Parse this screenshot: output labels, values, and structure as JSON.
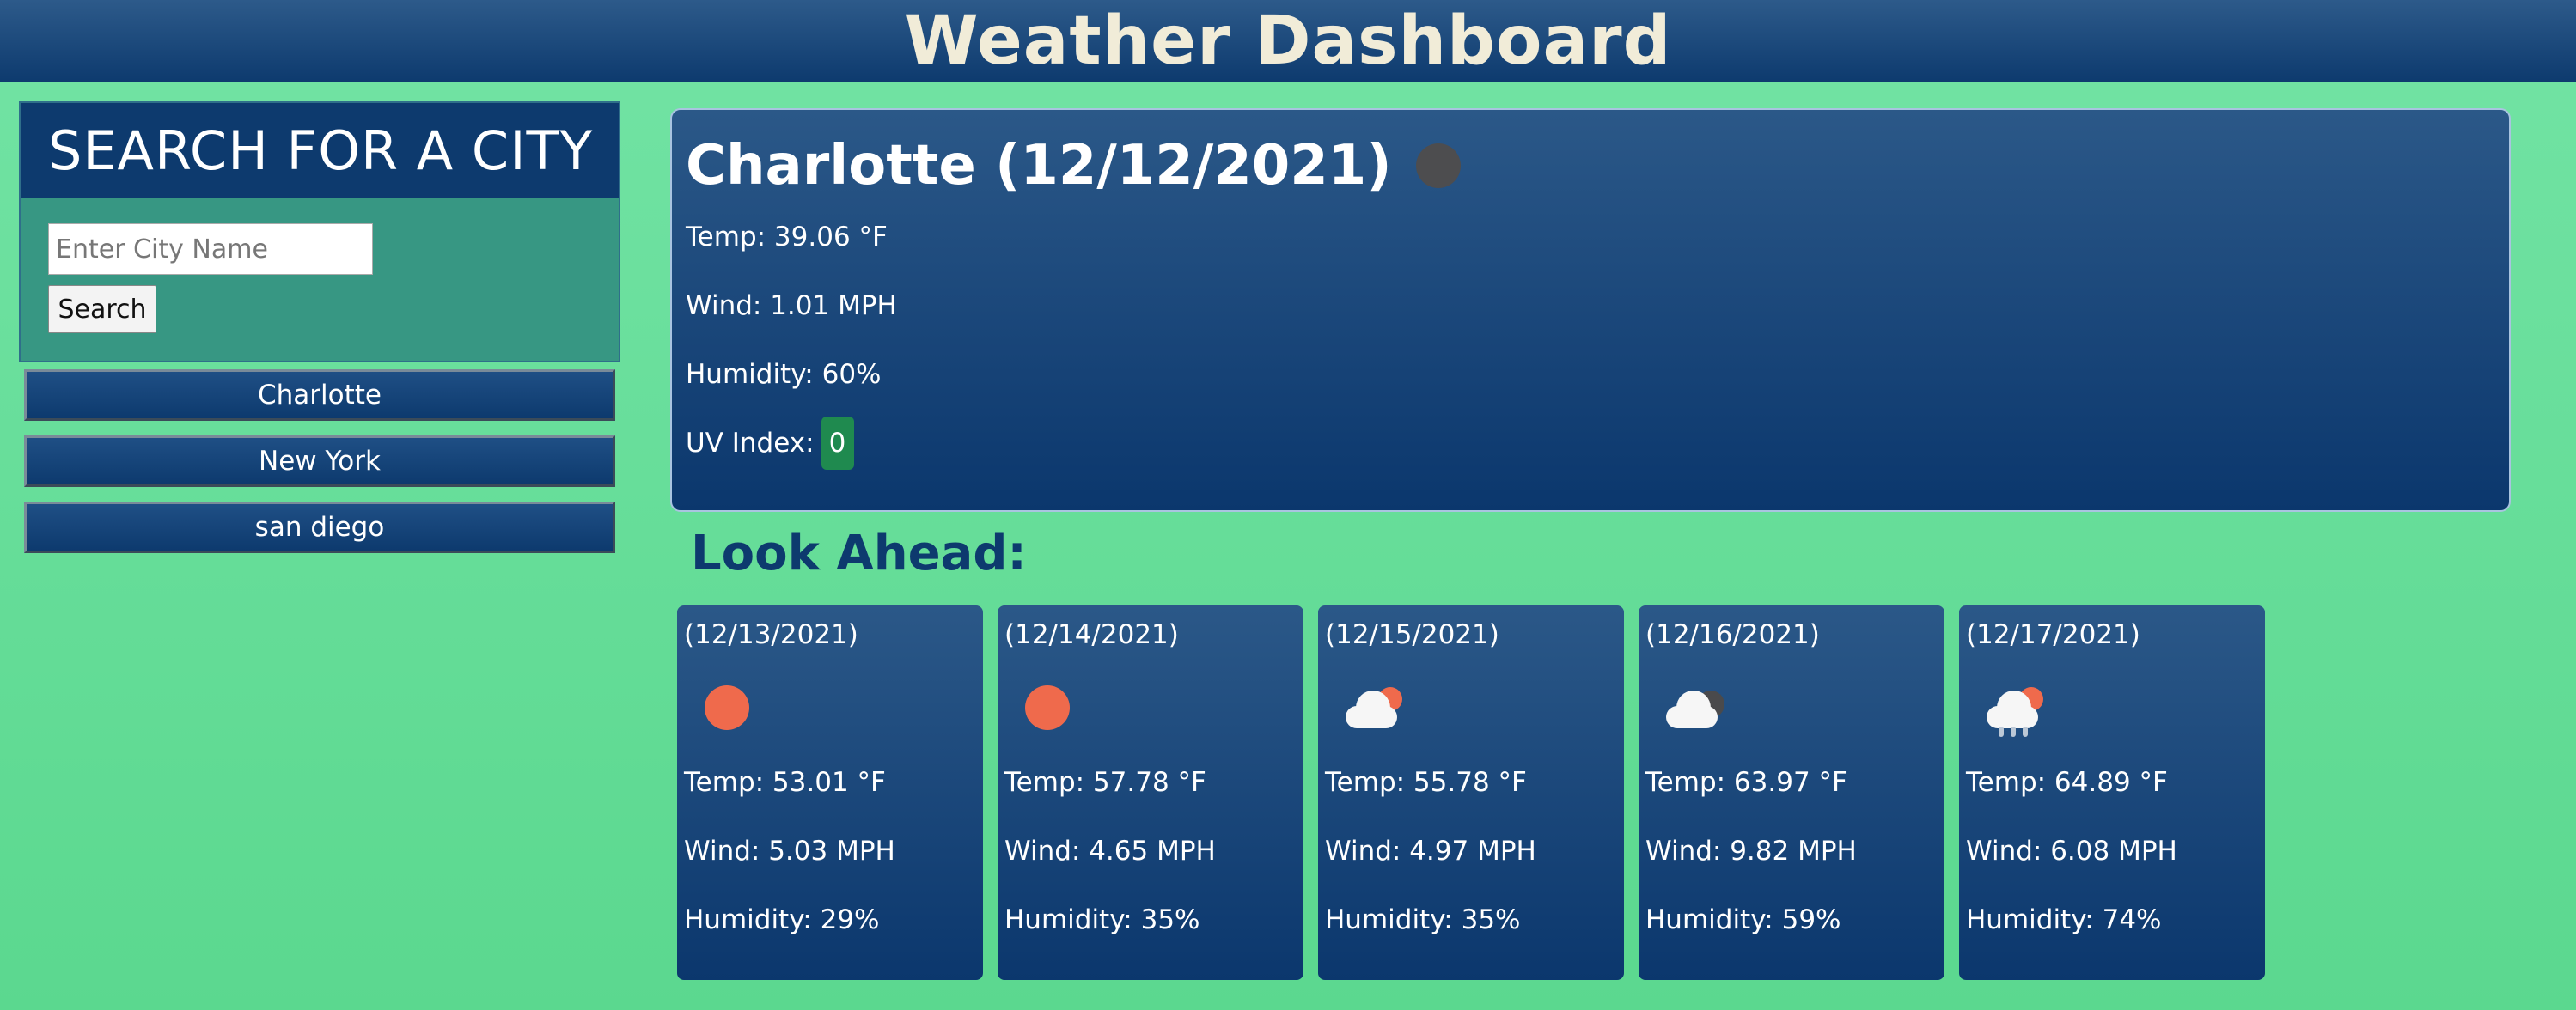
{
  "header": {
    "title": "Weather Dashboard"
  },
  "search": {
    "title": "SEARCH FOR A CITY",
    "placeholder": "Enter City Name",
    "value": "",
    "button_label": "Search"
  },
  "history": [
    "Charlotte",
    "New York",
    "san diego"
  ],
  "current": {
    "title": "Charlotte (12/12/2021)",
    "icon": "moon-icon",
    "temp": "Temp: 39.06 °F",
    "wind": "Wind: 1.01 MPH",
    "humidity": "Humidity: 60%",
    "uv_label": "UV Index:",
    "uv_value": "0",
    "uv_color": "#1f8a4f"
  },
  "forecast_title": "Look Ahead:",
  "forecast": [
    {
      "date": "(12/13/2021)",
      "icon": "sun-icon",
      "temp": "Temp: 53.01 °F",
      "wind": "Wind: 5.03 MPH",
      "humidity": "Humidity: 29%"
    },
    {
      "date": "(12/14/2021)",
      "icon": "sun-icon",
      "temp": "Temp: 57.78 °F",
      "wind": "Wind: 4.65 MPH",
      "humidity": "Humidity: 35%"
    },
    {
      "date": "(12/15/2021)",
      "icon": "partly-cloudy-icon",
      "temp": "Temp: 55.78 °F",
      "wind": "Wind: 4.97 MPH",
      "humidity": "Humidity: 35%"
    },
    {
      "date": "(12/16/2021)",
      "icon": "cloudy-night-icon",
      "temp": "Temp: 63.97 °F",
      "wind": "Wind: 9.82 MPH",
      "humidity": "Humidity: 59%"
    },
    {
      "date": "(12/17/2021)",
      "icon": "rain-icon",
      "temp": "Temp: 64.89 °F",
      "wind": "Wind: 6.08 MPH",
      "humidity": "Humidity: 74%"
    }
  ],
  "colors": {
    "header_bg": "#0d3a6e",
    "page_bg": "#6ae09c",
    "search_panel_bg": "#379783",
    "card_bg": "#0d3a6e",
    "sun": "#ef6a4c"
  }
}
